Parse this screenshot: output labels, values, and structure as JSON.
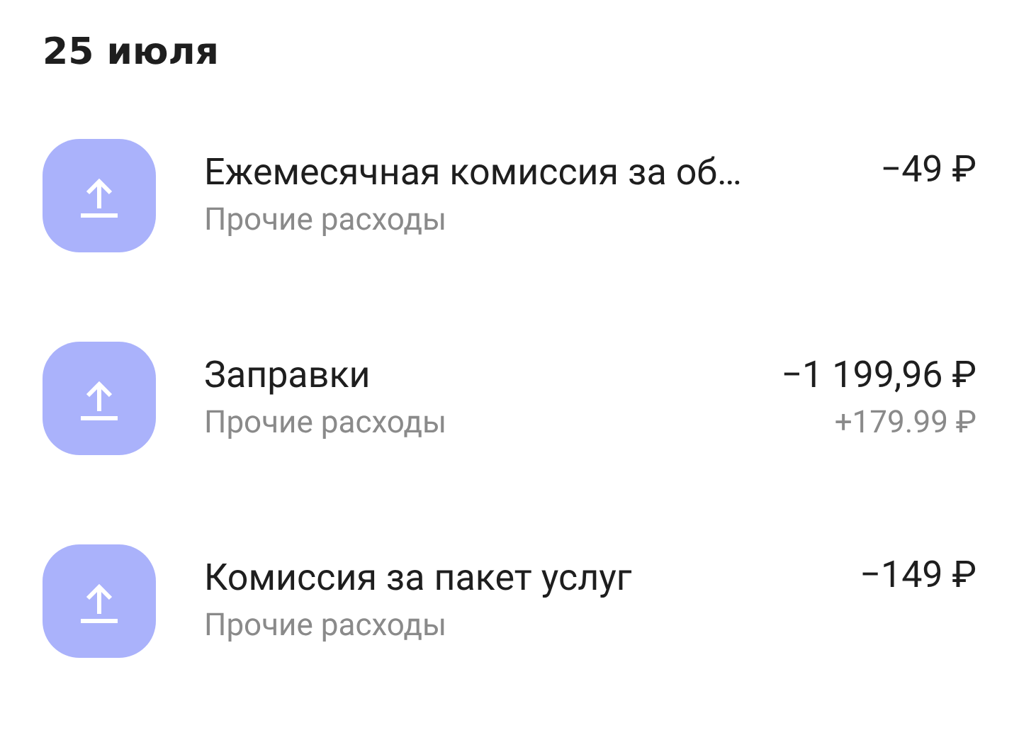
{
  "date_header": "25 июля",
  "transactions": [
    {
      "title": "Ежемесячная комиссия за об…",
      "category": "Прочие расходы",
      "amount": "−49 ₽"
    },
    {
      "title": "Заправки",
      "category": "Прочие расходы",
      "amount": "−1 199,96 ₽",
      "cashback": "+179.99 ₽"
    },
    {
      "title": "Комиссия за пакет услуг",
      "category": "Прочие расходы",
      "amount": "−149 ₽"
    }
  ]
}
